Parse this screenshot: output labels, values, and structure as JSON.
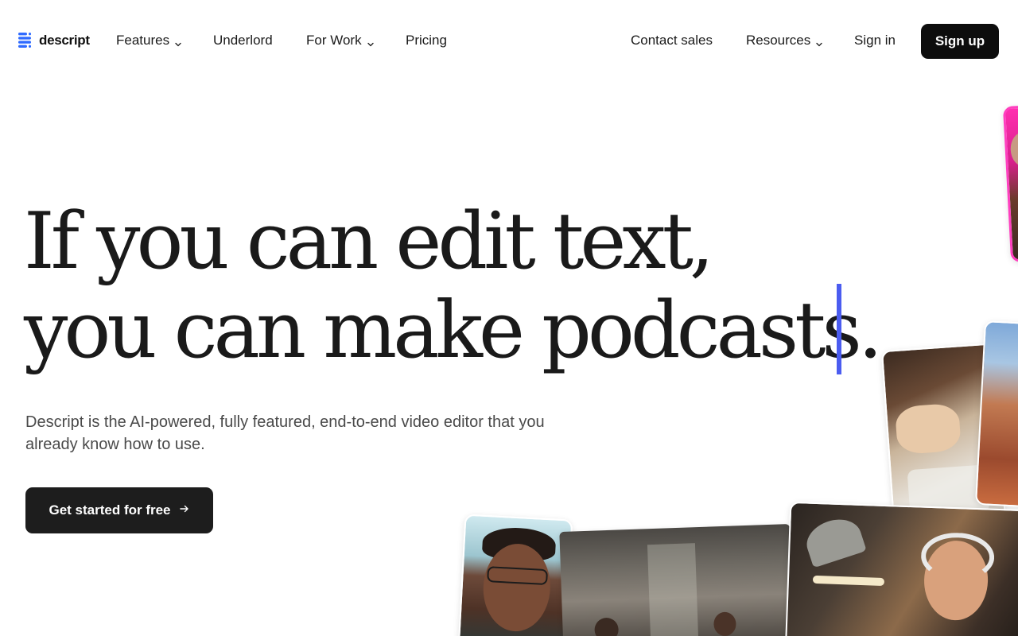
{
  "nav": {
    "logo_text": "descript",
    "features_label": "Features",
    "underlord_label": "Underlord",
    "for_work_label": "For Work",
    "pricing_label": "Pricing",
    "contact_sales_label": "Contact sales",
    "resources_label": "Resources",
    "sign_in_label": "Sign in",
    "sign_up_label": "Sign up"
  },
  "hero": {
    "headline_line1": "If you can edit text,",
    "headline_line2": "you can make podcasts.",
    "subhead": "Descript is the AI-powered, fully featured, end-to-end video editor that you already know how to use.",
    "cta_label": "Get started for free",
    "cta_icon": "arrow-right-icon"
  },
  "colors": {
    "brand_blue": "#2f6bff",
    "cursor_accent": "#4b5cf0",
    "button_dark": "#0d0d0d",
    "text_dark": "#1b1b1b",
    "text_muted": "#4a4a4a"
  },
  "icons": {
    "logo": "descript-logo-icon",
    "chevron": "chevron-down-icon",
    "arrow": "arrow-right-icon"
  }
}
